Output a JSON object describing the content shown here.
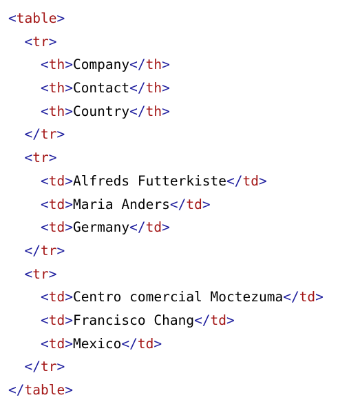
{
  "colors": {
    "tag_name": "#a31515",
    "angle_bracket": "#1e1e9e",
    "text_content": "#000000",
    "background": "#ffffff"
  },
  "lines": [
    {
      "indent": 0,
      "kind": "open",
      "tag": "table"
    },
    {
      "indent": 1,
      "kind": "open",
      "tag": "tr"
    },
    {
      "indent": 2,
      "kind": "element",
      "tag": "th",
      "text": "Company"
    },
    {
      "indent": 2,
      "kind": "element",
      "tag": "th",
      "text": "Contact"
    },
    {
      "indent": 2,
      "kind": "element",
      "tag": "th",
      "text": "Country"
    },
    {
      "indent": 1,
      "kind": "close",
      "tag": "tr"
    },
    {
      "indent": 1,
      "kind": "open",
      "tag": "tr"
    },
    {
      "indent": 2,
      "kind": "element",
      "tag": "td",
      "text": "Alfreds Futterkiste"
    },
    {
      "indent": 2,
      "kind": "element",
      "tag": "td",
      "text": "Maria Anders"
    },
    {
      "indent": 2,
      "kind": "element",
      "tag": "td",
      "text": "Germany"
    },
    {
      "indent": 1,
      "kind": "close",
      "tag": "tr"
    },
    {
      "indent": 1,
      "kind": "open",
      "tag": "tr"
    },
    {
      "indent": 2,
      "kind": "element",
      "tag": "td",
      "text": "Centro comercial Moctezuma"
    },
    {
      "indent": 2,
      "kind": "element",
      "tag": "td",
      "text": "Francisco Chang"
    },
    {
      "indent": 2,
      "kind": "element",
      "tag": "td",
      "text": "Mexico"
    },
    {
      "indent": 1,
      "kind": "close",
      "tag": "tr"
    },
    {
      "indent": 0,
      "kind": "close",
      "tag": "table"
    }
  ]
}
